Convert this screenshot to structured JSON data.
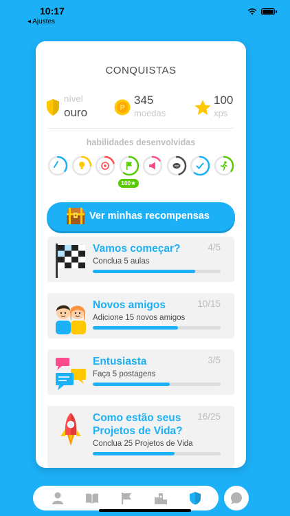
{
  "status": {
    "time": "10:17",
    "back_label": "◂ Ajustes"
  },
  "card": {
    "title": "CONQUISTAS",
    "stats": [
      {
        "icon": "shield-icon",
        "label": "nível",
        "value": "ouro"
      },
      {
        "icon": "coin-icon",
        "label": "moedas",
        "value": "345"
      },
      {
        "icon": "star-icon",
        "label": "xps",
        "value": "100"
      }
    ],
    "skills_title": "habilidades desenvolvidas",
    "skills": [
      {
        "icon": "gauge-icon",
        "color": "#1cb0f6",
        "progress": 0.35
      },
      {
        "icon": "lightbulb-icon",
        "color": "#ffc800",
        "progress": 0.25
      },
      {
        "icon": "target-icon",
        "color": "#ff4b4b",
        "progress": 0.2
      },
      {
        "icon": "flag-icon",
        "color": "#58cc02",
        "progress": 0.6
      },
      {
        "icon": "megaphone-icon",
        "color": "#ff4b8d",
        "progress": 0.15
      },
      {
        "icon": "handshake-icon",
        "color": "#4b4b4b",
        "progress": 0.45
      },
      {
        "icon": "check-icon",
        "color": "#1cb0f6",
        "progress": 0.6
      },
      {
        "icon": "runner-icon",
        "color": "#58cc02",
        "progress": 0.35
      }
    ],
    "skill_badge": "100★",
    "rewards_button": "Ver minhas recompensas",
    "achievements": [
      {
        "icon": "checkered-flag-icon",
        "title": "Vamos começar?",
        "count": "4/5",
        "desc": "Conclua 5 aulas",
        "progress": 0.8
      },
      {
        "icon": "friends-icon",
        "title": "Novos amigos",
        "count": "10/15",
        "desc": "Adicione 15 novos amigos",
        "progress": 0.667
      },
      {
        "icon": "chat-bubbles-icon",
        "title": "Entusiasta",
        "count": "3/5",
        "desc": "Faça 5 postagens",
        "progress": 0.6
      },
      {
        "icon": "rocket-icon",
        "title": "Como estão seus\nProjetos de Vida?",
        "count": "16/25",
        "desc": "Conclua 25 Projetos de Vida",
        "progress": 0.64
      }
    ]
  },
  "nav": {
    "items": [
      "profile-icon",
      "book-icon",
      "flag-icon",
      "leaderboard-icon",
      "shield-icon"
    ],
    "active": "shield-icon",
    "active_color": "#1cb0f6",
    "inactive_color": "#b3b3b3"
  }
}
